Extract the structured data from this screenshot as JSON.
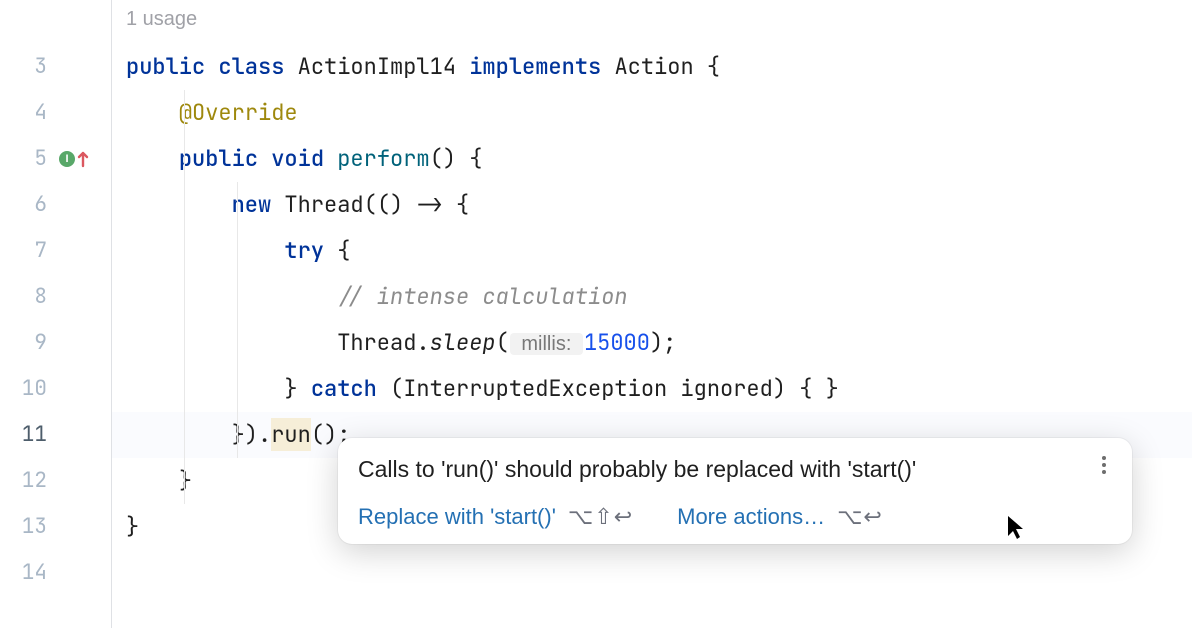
{
  "usage_hint": "1 usage",
  "lines": [
    {
      "num": 3,
      "indent": 0
    },
    {
      "num": 4,
      "indent": 1
    },
    {
      "num": 5,
      "indent": 1,
      "gutter_icon": true
    },
    {
      "num": 6,
      "indent": 2
    },
    {
      "num": 7,
      "indent": 3
    },
    {
      "num": 8,
      "indent": 4
    },
    {
      "num": 9,
      "indent": 4
    },
    {
      "num": 10,
      "indent": 3
    },
    {
      "num": 11,
      "indent": 2,
      "current": true
    },
    {
      "num": 12,
      "indent": 1
    },
    {
      "num": 13,
      "indent": 0
    },
    {
      "num": 14,
      "indent": 0
    }
  ],
  "tokens": {
    "l3": {
      "kw_public": "public",
      "kw_class": "class",
      "cls_name": "ActionImpl14",
      "kw_impl": "implements",
      "intf": "Action",
      "brace": " {"
    },
    "l4": {
      "anno": "@Override"
    },
    "l5": {
      "kw_public": "public",
      "kw_void": "void",
      "mname": "perform",
      "rest": "() {"
    },
    "l6": {
      "kw_new": "new",
      "cls": "Thread",
      "rest": "(() -> {"
    },
    "l7": {
      "kw_try": "try",
      "rest": " {"
    },
    "l8": {
      "cmt": "// intense calculation"
    },
    "l9": {
      "cls": "Thread",
      "dot": ".",
      "m": "sleep",
      "open": "(",
      "hint": " millis: ",
      "num": "15000",
      "close": ");"
    },
    "l10": {
      "close_br": "} ",
      "kw_catch": "catch",
      "rest": " (InterruptedException ignored) { }"
    },
    "l11": {
      "pre": "}).",
      "hl": "run",
      "post": "();"
    },
    "l12": {
      "t": "}"
    },
    "l13": {
      "t": "}"
    }
  },
  "tooltip": {
    "title": "Calls to 'run()' should probably be replaced with 'start()'",
    "action1_label": "Replace with 'start()'",
    "action1_kbd": "⌥⇧↩",
    "action2_label": "More actions…",
    "action2_kbd": "⌥↩"
  }
}
